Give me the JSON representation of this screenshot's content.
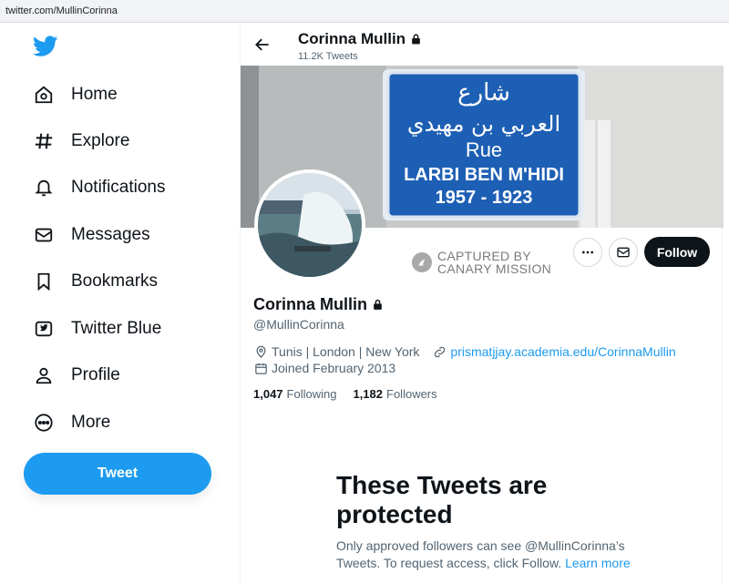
{
  "browser": {
    "url": "twitter.com/MullinCorinna"
  },
  "sidebar": {
    "items": [
      {
        "label": "Home",
        "icon": "home-icon"
      },
      {
        "label": "Explore",
        "icon": "hashtag-icon"
      },
      {
        "label": "Notifications",
        "icon": "bell-icon"
      },
      {
        "label": "Messages",
        "icon": "envelope-icon"
      },
      {
        "label": "Bookmarks",
        "icon": "bookmark-icon"
      },
      {
        "label": "Twitter Blue",
        "icon": "twitter-blue-icon"
      },
      {
        "label": "Profile",
        "icon": "person-icon"
      },
      {
        "label": "More",
        "icon": "more-circle-icon"
      }
    ],
    "tweet_button": "Tweet"
  },
  "header": {
    "name": "Corinna Mullin",
    "tweet_count": "11.2K Tweets"
  },
  "banner": {
    "sign_arabic_1": "شارع",
    "sign_arabic_2": "العربي بن مهيدي",
    "sign_line_rue": "Rue",
    "sign_line_name": "LARBI BEN M'HIDI",
    "sign_line_years": "1957 - 1923"
  },
  "watermark": {
    "line1": "CAPTURED BY",
    "line2": "CANARY MISSION"
  },
  "actions": {
    "follow": "Follow"
  },
  "profile": {
    "name": "Corinna Mullin",
    "handle": "@MullinCorinna",
    "location": "Tunis | London | New York",
    "website": "prismatjjay.academia.edu/CorinnaMullin",
    "joined": "Joined February 2013",
    "following_count": "1,047",
    "following_label": "Following",
    "followers_count": "1,182",
    "followers_label": "Followers"
  },
  "protected": {
    "title": "These Tweets are protected",
    "body": "Only approved followers can see @MullinCorinna’s Tweets. To request access, click Follow.",
    "learn_more": "Learn more"
  },
  "colors": {
    "accent": "#1d9bf0",
    "text": "#0f1419",
    "muted": "#536471",
    "sign_blue": "#1d5fb4"
  }
}
